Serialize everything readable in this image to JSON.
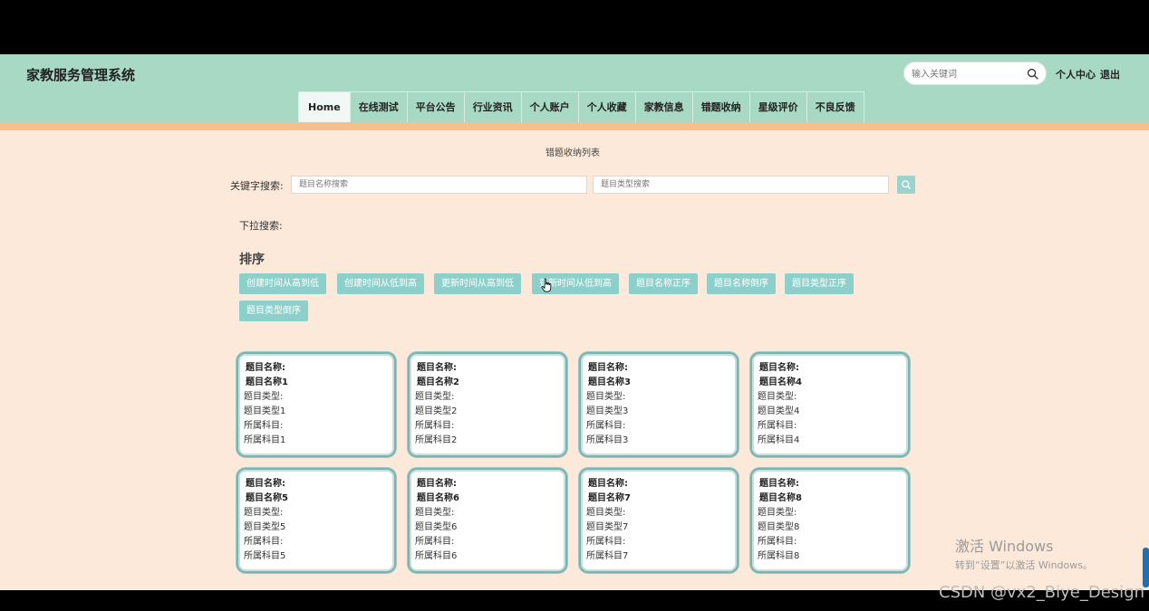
{
  "header": {
    "site_title": "家教服务管理系统",
    "search_placeholder": "输入关键词",
    "user_center": "个人中心",
    "logout": "退出"
  },
  "nav": [
    {
      "label": "Home",
      "active": true
    },
    {
      "label": "在线测试"
    },
    {
      "label": "平台公告"
    },
    {
      "label": "行业资讯"
    },
    {
      "label": "个人账户"
    },
    {
      "label": "个人收藏"
    },
    {
      "label": "家教信息"
    },
    {
      "label": "错题收纳"
    },
    {
      "label": "星级评价"
    },
    {
      "label": "不良反馈"
    }
  ],
  "main": {
    "list_title": "错题收纳列表",
    "keyword_label": "关键字搜索:",
    "name_placeholder": "题目名称搜索",
    "type_placeholder": "题目类型搜索",
    "dropdown_label": "下拉搜索:",
    "sort_title": "排序",
    "sort_buttons": [
      "创建时间从高到低",
      "创建时间从低到高",
      "更新时间从高到低",
      "更新时间从低到高",
      "题目名称正序",
      "题目名称倒序",
      "题目类型正序",
      "题目类型倒序"
    ]
  },
  "cards": [
    {
      "name_label": "题目名称:",
      "name": "题目名称1",
      "type_label": "题目类型:",
      "type": "题目类型1",
      "subject_label": "所属科目:",
      "subject": "所属科目1"
    },
    {
      "name_label": "题目名称:",
      "name": "题目名称2",
      "type_label": "题目类型:",
      "type": "题目类型2",
      "subject_label": "所属科目:",
      "subject": "所属科目2"
    },
    {
      "name_label": "题目名称:",
      "name": "题目名称3",
      "type_label": "题目类型:",
      "type": "题目类型3",
      "subject_label": "所属科目:",
      "subject": "所属科目3"
    },
    {
      "name_label": "题目名称:",
      "name": "题目名称4",
      "type_label": "题目类型:",
      "type": "题目类型4",
      "subject_label": "所属科目:",
      "subject": "所属科目4"
    },
    {
      "name_label": "题目名称:",
      "name": "题目名称5",
      "type_label": "题目类型:",
      "type": "题目类型5",
      "subject_label": "所属科目:",
      "subject": "所属科目5"
    },
    {
      "name_label": "题目名称:",
      "name": "题目名称6",
      "type_label": "题目类型:",
      "type": "题目类型6",
      "subject_label": "所属科目:",
      "subject": "所属科目6"
    },
    {
      "name_label": "题目名称:",
      "name": "题目名称7",
      "type_label": "题目类型:",
      "type": "题目类型7",
      "subject_label": "所属科目:",
      "subject": "所属科目7"
    },
    {
      "name_label": "题目名称:",
      "name": "题目名称8",
      "type_label": "题目类型:",
      "type": "题目类型8",
      "subject_label": "所属科目:",
      "subject": "所属科目8"
    }
  ],
  "overlay": {
    "activate_title": "激活 Windows",
    "activate_sub": "转到“设置”以激活 Windows。",
    "watermark": "CSDN @vx2_Biye_Design"
  },
  "colors": {
    "header_bg": "#a8d9c5",
    "stripe": "#f6bf8e",
    "page_bg": "#fde9d9",
    "button_bg": "#8dd0cb",
    "card_border": "#7cb3b0"
  }
}
